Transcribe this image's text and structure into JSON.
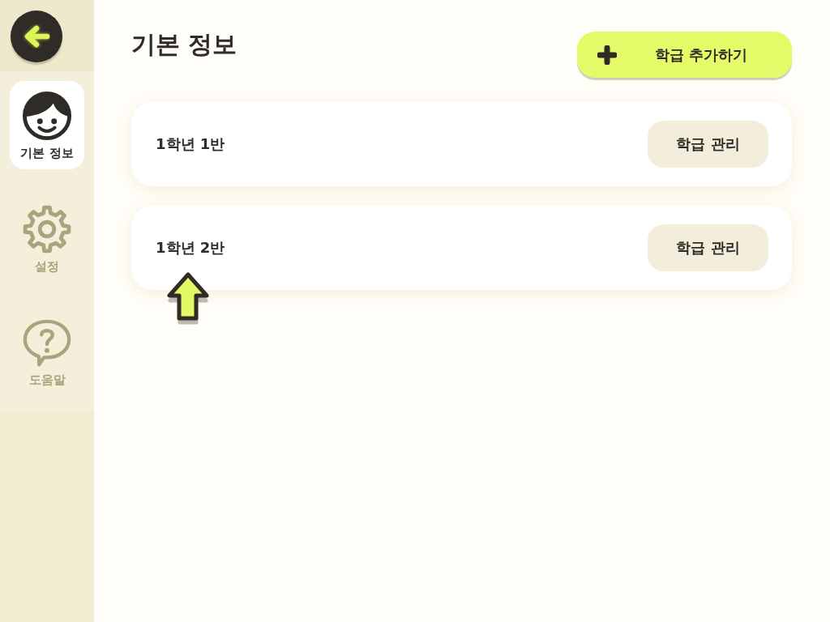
{
  "sidebar": {
    "items": [
      {
        "kind": "profile",
        "label": "기본 정보",
        "selected": true
      },
      {
        "kind": "settings",
        "label": "설정",
        "selected": false
      },
      {
        "kind": "help",
        "label": "도움말",
        "selected": false
      }
    ]
  },
  "header": {
    "title": "기본 정보",
    "add_button": "학급 추가하기"
  },
  "classes": [
    {
      "name": "1학년 1반",
      "button": "학급 관리"
    },
    {
      "name": "1학년 2반",
      "button": "학급 관리"
    }
  ]
}
